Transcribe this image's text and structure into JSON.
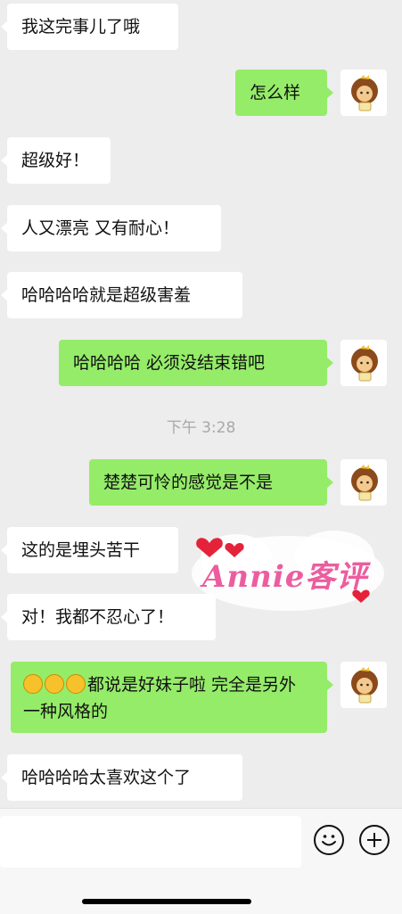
{
  "messages": [
    {
      "side": "in",
      "text": "我这完事儿了哦"
    },
    {
      "side": "out",
      "text": "怎么样"
    },
    {
      "side": "in",
      "text": "超级好！"
    },
    {
      "side": "in",
      "text": "人又漂亮 又有耐心！"
    },
    {
      "side": "in",
      "text": "哈哈哈哈就是超级害羞"
    },
    {
      "side": "out",
      "text": "哈哈哈哈 必须没结束错吧"
    },
    {
      "side": "out",
      "text": "楚楚可怜的感觉是不是"
    },
    {
      "side": "in",
      "text": "这的是埋头苦干"
    },
    {
      "side": "in",
      "text": "对！我都不忍心了！"
    },
    {
      "side": "out",
      "text": "都说是好妹子啦 完全是另外一种风格的",
      "emoji_prefix": [
        "laughing-tears-icon",
        "laughing-tears-icon",
        "laughing-tears-icon"
      ]
    },
    {
      "side": "in",
      "text": "哈哈哈哈太喜欢这个了"
    }
  ],
  "timestamp": "下午 3:28",
  "watermark": {
    "text": "Annie客评"
  },
  "input_bar": {
    "input_value": "",
    "emoji_button_icon": "smiley-icon",
    "plus_button_icon": "plus-circle-icon"
  },
  "colors": {
    "background": "#ededed",
    "incoming_bubble": "#ffffff",
    "outgoing_bubble": "#95ec69",
    "watermark_text": "#ec5d9f"
  }
}
